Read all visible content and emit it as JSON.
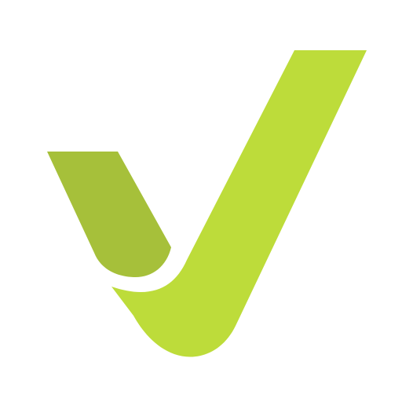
{
  "logo": {
    "icon": "checkmark-icon",
    "colors": {
      "background": "#ffffff",
      "short_stroke": "#a6c03a",
      "long_stroke": "#bddc3a"
    }
  }
}
